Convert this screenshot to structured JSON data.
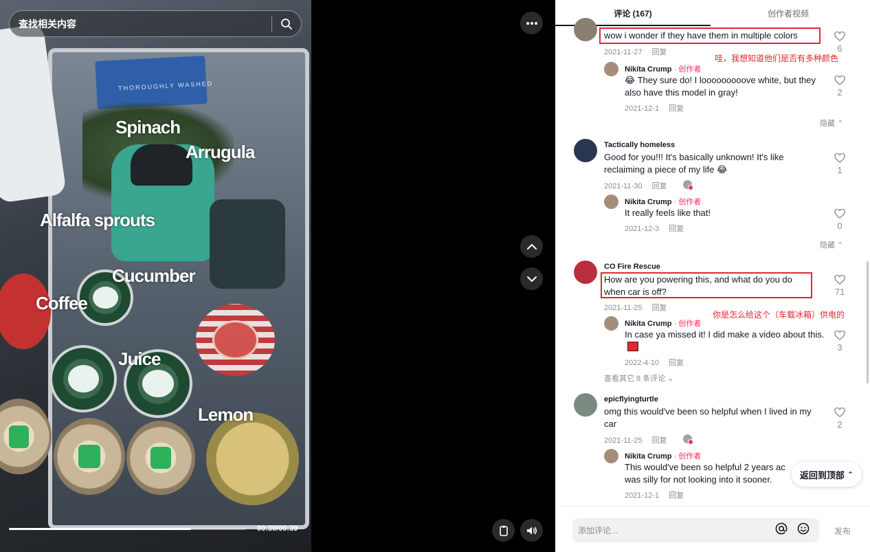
{
  "search": {
    "placeholder": "查找相关内容"
  },
  "video": {
    "labels": {
      "spinach": "Spinach",
      "arrugula": "Arrugula",
      "alfalfa": "Alfalfa sprouts",
      "cucumber": "Cucumber",
      "coffee": "Coffee",
      "juice": "Juice",
      "lemon": "Lemon"
    },
    "packaging": {
      "bag": "THOROUGHLY WASHED"
    },
    "time": "00:30/00:39",
    "progress": 0.769
  },
  "tabs": {
    "comments": "评论 (167)",
    "creator_videos": "创作者视频"
  },
  "comments": [
    {
      "text": "wow i wonder if they have them in multiple colors",
      "date": "2021-11-27",
      "reply": "回复",
      "likes": "6",
      "annotation": "哇，我想知道他们是否有多种颜色",
      "replies": [
        {
          "name": "Nikita Crump",
          "badge": " · 创作者",
          "text": "😂 They sure do! I looooooooove white, but they also have this model in gray!",
          "date": "2021-12-1",
          "reply": "回复",
          "likes": "2"
        }
      ],
      "hide": "隐藏"
    },
    {
      "name": "Tactically homeless",
      "text": "Good for you!!! It's basically unknown! It's like reclaiming a piece of my life 😂",
      "date": "2021-11-30",
      "reply": "回复",
      "likes": "1",
      "replies": [
        {
          "name": "Nikita Crump",
          "badge": " · 创作者",
          "text": "It really feels like that!",
          "date": "2021-12-3",
          "reply": "回复",
          "likes": "0"
        }
      ],
      "hide": "隐藏"
    },
    {
      "name": "CO Fire Rescue",
      "text": "How are you powering this, and what do you do when car is off?",
      "date": "2021-11-25",
      "reply": "回复",
      "likes": "71",
      "annotation": "你是怎么给这个（车载冰箱）供电的",
      "replies": [
        {
          "name": "Nikita Crump",
          "badge": " · 创作者",
          "text": "In case ya missed it! I did make a video about this.",
          "date": "2022-4-10",
          "reply": "回复",
          "likes": "3"
        }
      ],
      "more": "查看其它 8 条评论"
    },
    {
      "name": "epicflyingturtle",
      "text": "omg this would've been so helpful when I lived in my car",
      "date": "2021-11-25",
      "reply": "回复",
      "likes": "2",
      "replies": [
        {
          "name": "Nikita Crump",
          "badge": " · 创作者",
          "text": "This would've been so helpful 2 years ac",
          "text2": "was silly for not looking into it sooner.",
          "date": "2021-12-1",
          "reply": "回复"
        }
      ]
    }
  ],
  "back_to_top": "返回到顶部",
  "footer": {
    "placeholder": "添加评论...",
    "post": "发布"
  },
  "colors": {
    "accent": "#fe2c55",
    "annotation": "#e5262f",
    "text": "#161823",
    "muted": "#8a8b91"
  }
}
